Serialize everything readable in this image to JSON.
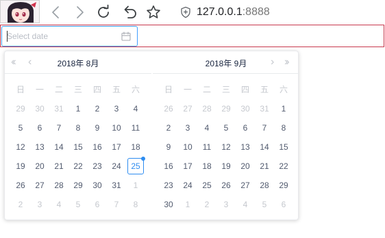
{
  "browser": {
    "url_host": "127.0.0.1",
    "url_port": ":8888",
    "buttons": [
      {
        "name": "back-button",
        "icon": "back-arrow-icon"
      },
      {
        "name": "forward-button",
        "icon": "forward-arrow-icon"
      },
      {
        "name": "reload-button",
        "icon": "reload-icon"
      },
      {
        "name": "undo-button",
        "icon": "undo-icon"
      },
      {
        "name": "bookmark-button",
        "icon": "star-icon"
      }
    ],
    "security_icon": "shield-icon",
    "avatar": "anime-avatar"
  },
  "date_input": {
    "placeholder": "Select date",
    "icon": "calendar-icon",
    "focus_color": "#409eff"
  },
  "picker": {
    "weekdays": [
      "日",
      "一",
      "二",
      "三",
      "四",
      "五",
      "六"
    ],
    "accent": "#2d8cf0",
    "months": [
      {
        "title": "2018年 8月",
        "show_prev": true,
        "show_next": false,
        "weeks": [
          [
            {
              "d": "29",
              "m": true
            },
            {
              "d": "30",
              "m": true
            },
            {
              "d": "31",
              "m": true
            },
            {
              "d": "1"
            },
            {
              "d": "2"
            },
            {
              "d": "3"
            },
            {
              "d": "4"
            }
          ],
          [
            {
              "d": "5"
            },
            {
              "d": "6"
            },
            {
              "d": "7"
            },
            {
              "d": "8"
            },
            {
              "d": "9"
            },
            {
              "d": "10"
            },
            {
              "d": "11"
            }
          ],
          [
            {
              "d": "12"
            },
            {
              "d": "13"
            },
            {
              "d": "14"
            },
            {
              "d": "15"
            },
            {
              "d": "16"
            },
            {
              "d": "17"
            },
            {
              "d": "18"
            }
          ],
          [
            {
              "d": "19"
            },
            {
              "d": "20"
            },
            {
              "d": "21"
            },
            {
              "d": "22"
            },
            {
              "d": "23"
            },
            {
              "d": "24"
            },
            {
              "d": "25",
              "today": true
            }
          ],
          [
            {
              "d": "26"
            },
            {
              "d": "27"
            },
            {
              "d": "28"
            },
            {
              "d": "29"
            },
            {
              "d": "30"
            },
            {
              "d": "31"
            },
            {
              "d": "1",
              "m": true
            }
          ],
          [
            {
              "d": "2",
              "m": true
            },
            {
              "d": "3",
              "m": true
            },
            {
              "d": "4",
              "m": true
            },
            {
              "d": "5",
              "m": true
            },
            {
              "d": "6",
              "m": true
            },
            {
              "d": "7",
              "m": true
            },
            {
              "d": "8",
              "m": true
            }
          ]
        ]
      },
      {
        "title": "2018年 9月",
        "show_prev": false,
        "show_next": true,
        "weeks": [
          [
            {
              "d": "26",
              "m": true
            },
            {
              "d": "27",
              "m": true
            },
            {
              "d": "28",
              "m": true
            },
            {
              "d": "29",
              "m": true
            },
            {
              "d": "30",
              "m": true
            },
            {
              "d": "31",
              "m": true
            },
            {
              "d": "1"
            }
          ],
          [
            {
              "d": "2"
            },
            {
              "d": "3"
            },
            {
              "d": "4"
            },
            {
              "d": "5"
            },
            {
              "d": "6"
            },
            {
              "d": "7"
            },
            {
              "d": "8"
            }
          ],
          [
            {
              "d": "9"
            },
            {
              "d": "10"
            },
            {
              "d": "11"
            },
            {
              "d": "12"
            },
            {
              "d": "13"
            },
            {
              "d": "14"
            },
            {
              "d": "15"
            }
          ],
          [
            {
              "d": "16"
            },
            {
              "d": "17"
            },
            {
              "d": "18"
            },
            {
              "d": "19"
            },
            {
              "d": "20"
            },
            {
              "d": "21"
            },
            {
              "d": "22"
            }
          ],
          [
            {
              "d": "23"
            },
            {
              "d": "24"
            },
            {
              "d": "25"
            },
            {
              "d": "26"
            },
            {
              "d": "27"
            },
            {
              "d": "28"
            },
            {
              "d": "29"
            }
          ],
          [
            {
              "d": "30"
            },
            {
              "d": "1",
              "m": true
            },
            {
              "d": "2",
              "m": true
            },
            {
              "d": "3",
              "m": true
            },
            {
              "d": "4",
              "m": true
            },
            {
              "d": "5",
              "m": true
            },
            {
              "d": "6",
              "m": true
            }
          ]
        ]
      }
    ]
  }
}
